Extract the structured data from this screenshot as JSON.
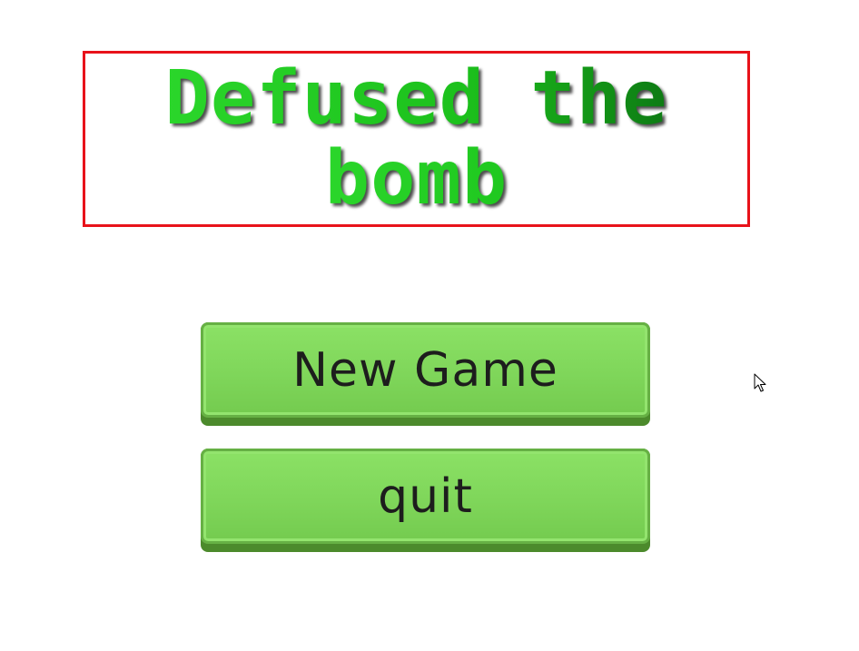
{
  "title": {
    "line1": "Defused the",
    "line2": "bomb",
    "border_color": "#e8121a",
    "text_color": "#1ec41e"
  },
  "menu": {
    "buttons": [
      {
        "label": "New Game"
      },
      {
        "label": "quit"
      }
    ],
    "button_color": "#7fd65a"
  },
  "cursor": {
    "icon": "mouse-pointer-icon"
  }
}
